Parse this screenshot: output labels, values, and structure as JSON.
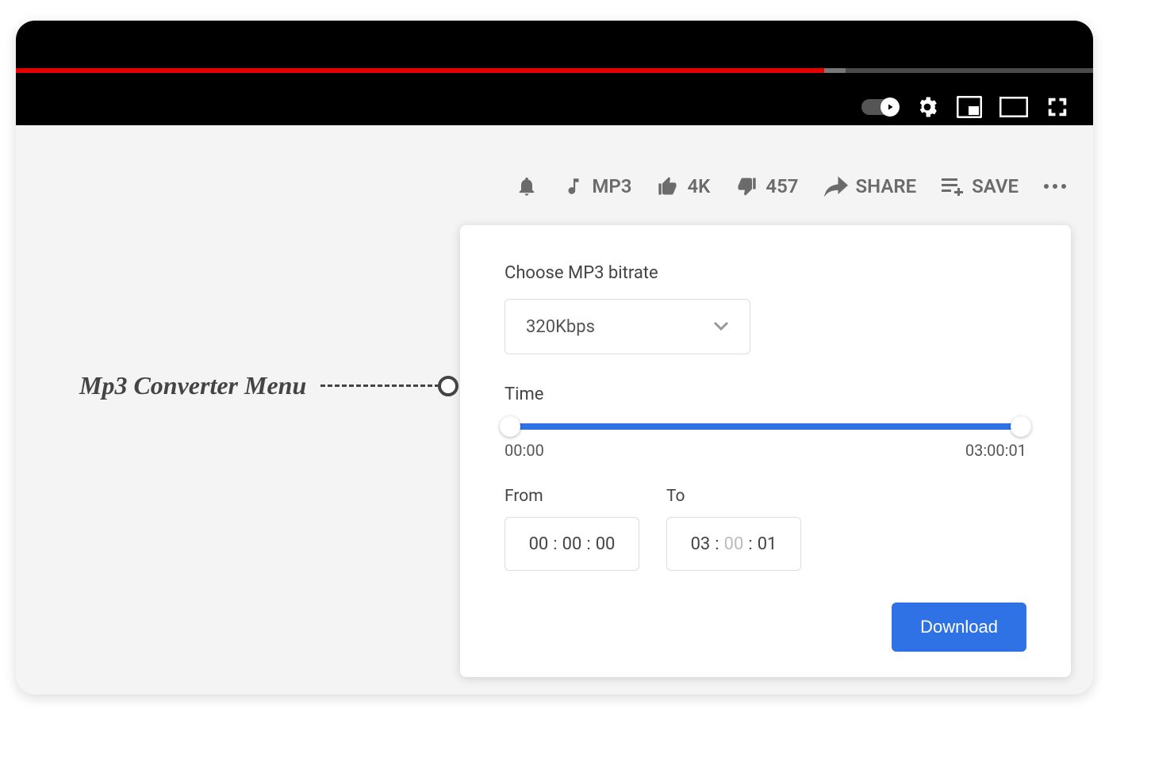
{
  "actions": {
    "mp3": "MP3",
    "likes": "4K",
    "dislikes": "457",
    "share": "SHARE",
    "save": "SAVE"
  },
  "panel": {
    "bitrate_label": "Choose MP3 bitrate",
    "bitrate_value": "320Kbps",
    "time_label": "Time",
    "time_start": "00:00",
    "time_end": "03:00:01",
    "from_label": "From",
    "to_label": "To",
    "from_hh": "00",
    "from_mm": "00",
    "from_ss": "00",
    "to_hh": "03",
    "to_mm": "00",
    "to_ss": "01",
    "download": "Download"
  },
  "annotation": {
    "label": "Mp3 Converter Menu"
  }
}
